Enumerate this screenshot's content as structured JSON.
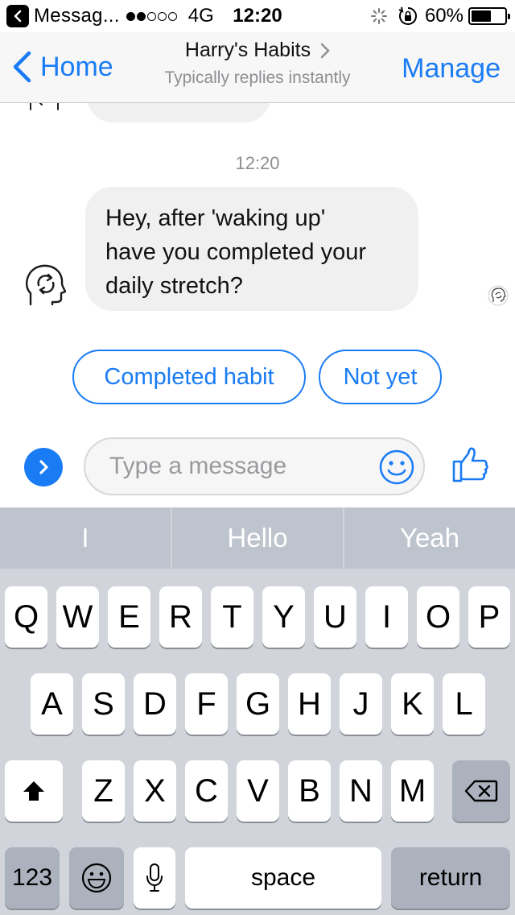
{
  "status_bar": {
    "app_back_label": "Messag...",
    "network": "4G",
    "time": "12:20",
    "battery_percent": "60%",
    "battery_level": 0.6
  },
  "nav": {
    "back_label": "Home",
    "title": "Harry's Habits",
    "subtitle": "Typically replies instantly",
    "action_label": "Manage",
    "accent_color": "#1a7cf5"
  },
  "chat": {
    "timestamp": "12:20",
    "message": {
      "line1": "Hey, after 'waking up'",
      "line2": "have you completed your",
      "line3": "daily stretch?"
    },
    "quick_replies": [
      "Completed habit",
      "Not yet"
    ]
  },
  "composer": {
    "placeholder": "Type a message",
    "icons": [
      "chevron-right-icon",
      "smiley-icon",
      "thumbs-up-icon"
    ]
  },
  "keyboard": {
    "predictions": [
      "I",
      "Hello",
      "Yeah"
    ],
    "row1": [
      "Q",
      "W",
      "E",
      "R",
      "T",
      "Y",
      "U",
      "I",
      "O",
      "P"
    ],
    "row2": [
      "A",
      "S",
      "D",
      "F",
      "G",
      "H",
      "J",
      "K",
      "L"
    ],
    "row3": [
      "Z",
      "X",
      "C",
      "V",
      "B",
      "N",
      "M"
    ],
    "numbers_label": "123",
    "space_label": "space",
    "return_label": "return"
  }
}
